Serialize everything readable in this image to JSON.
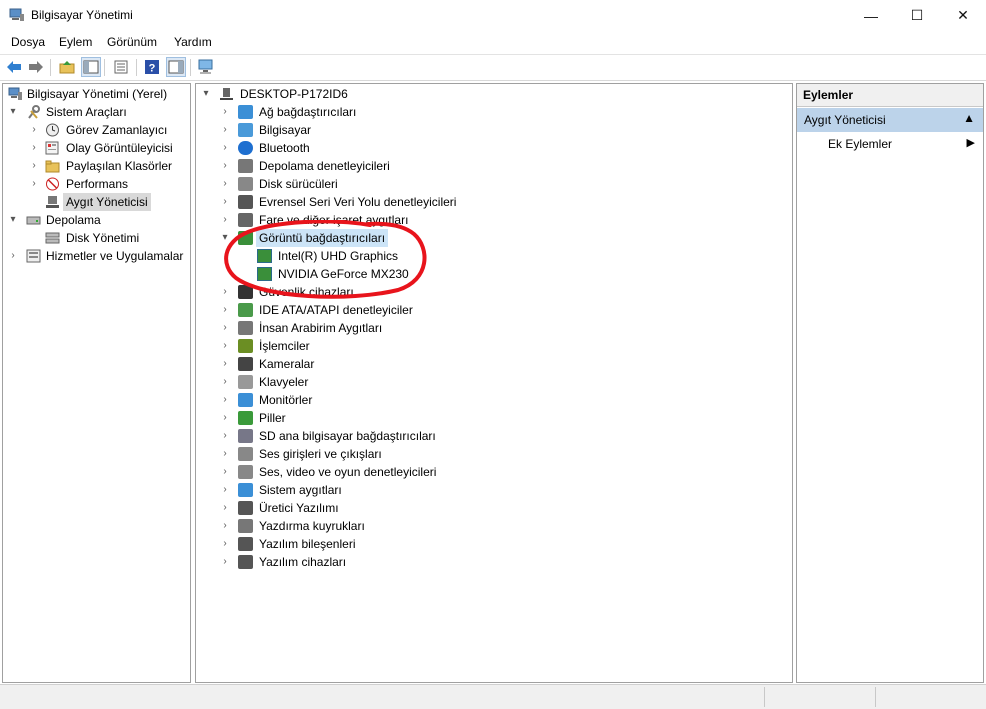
{
  "window": {
    "title": "Bilgisayar Yönetimi",
    "controls": {
      "minimize": "—",
      "maximize": "☐",
      "close": "✕"
    }
  },
  "menu": {
    "items": [
      "Dosya",
      "Eylem",
      "Görünüm",
      "Yardım"
    ]
  },
  "toolbar": {
    "icons": [
      "back-arrow-icon",
      "forward-arrow-icon",
      "up-folder-icon",
      "show-hide-tree-icon",
      "properties-icon",
      "help-icon",
      "action-pane-icon",
      "monitor-scan-icon"
    ]
  },
  "left_tree": {
    "root": "Bilgisayar Yönetimi (Yerel)",
    "system_tools": "Sistem Araçları",
    "task_scheduler": "Görev Zamanlayıcı",
    "event_viewer": "Olay Görüntüleyicisi",
    "shared_folders": "Paylaşılan Klasörler",
    "performance": "Performans",
    "device_manager": "Aygıt Yöneticisi",
    "storage": "Depolama",
    "disk_management": "Disk Yönetimi",
    "services": "Hizmetler ve Uygulamalar"
  },
  "device_tree": {
    "computer": "DESKTOP-P172ID6",
    "categories": [
      "Ağ bağdaştırıcıları",
      "Bilgisayar",
      "Bluetooth",
      "Depolama denetleyicileri",
      "Disk sürücüleri",
      "Evrensel Seri Veri Yolu denetleyicileri",
      "Fare ve diğer işaret aygıtları",
      "Görüntü bağdaştırıcıları",
      "Güvenlik cihazları",
      "IDE ATA/ATAPI denetleyiciler",
      "İnsan Arabirim Aygıtları",
      "İşlemciler",
      "Kameralar",
      "Klavyeler",
      "Monitörler",
      "Piller",
      "SD ana bilgisayar bağdaştırıcıları",
      "Ses girişleri ve çıkışları",
      "Ses, video ve oyun denetleyicileri",
      "Sistem aygıtları",
      "Üretici Yazılımı",
      "Yazdırma kuyrukları",
      "Yazılım bileşenleri",
      "Yazılım cihazları"
    ],
    "display_children": [
      "Intel(R) UHD Graphics",
      "NVIDIA GeForce MX230"
    ]
  },
  "actions": {
    "header": "Eylemler",
    "section": "Aygıt Yöneticisi",
    "more": "Ek Eylemler"
  },
  "annotation": {
    "color": "#e8141c"
  }
}
